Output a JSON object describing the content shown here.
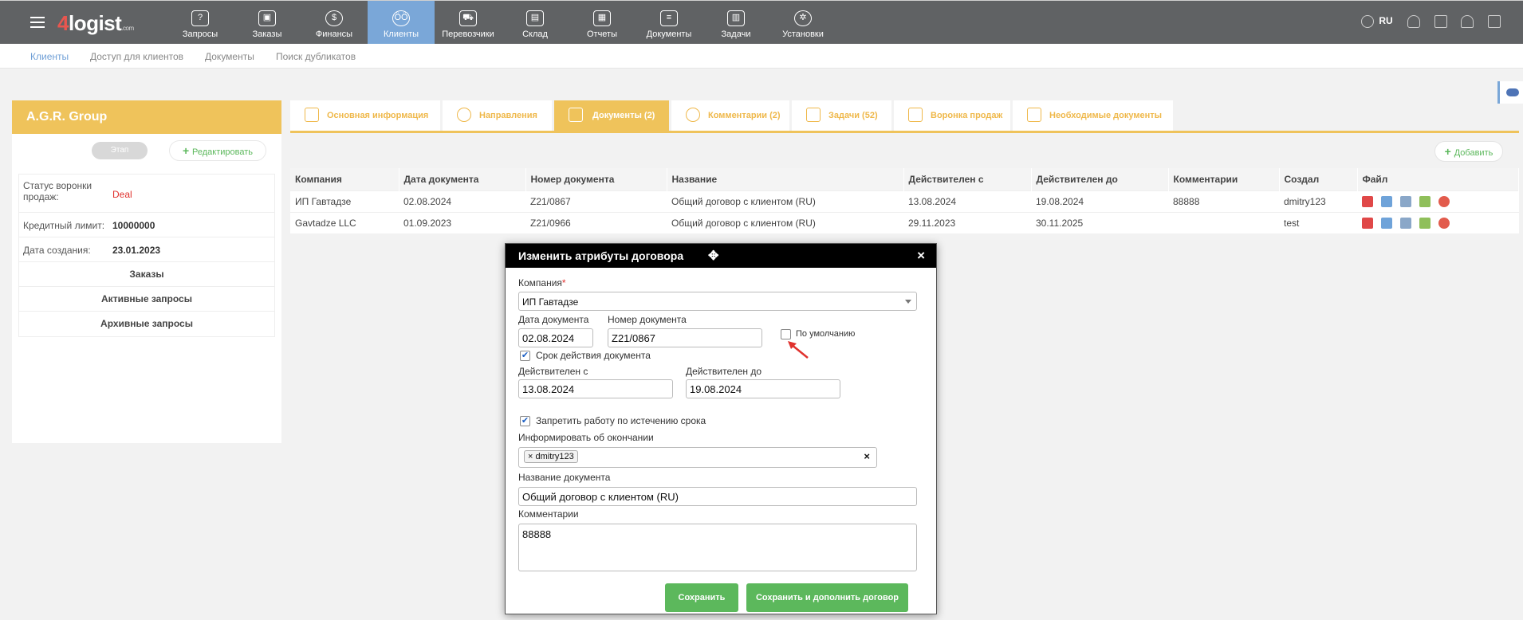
{
  "logo": {
    "four": "4",
    "rest": "logist",
    "suffix": ".com"
  },
  "nav": [
    {
      "label": "Запросы",
      "icon": "chat-icon"
    },
    {
      "label": "Заказы",
      "icon": "boxes-icon"
    },
    {
      "label": "Финансы",
      "icon": "money-bag-icon"
    },
    {
      "label": "Клиенты",
      "icon": "users-icon",
      "active": true
    },
    {
      "label": "Перевозчики",
      "icon": "truck-icon"
    },
    {
      "label": "Склад",
      "icon": "warehouse-icon"
    },
    {
      "label": "Отчеты",
      "icon": "calculator-icon"
    },
    {
      "label": "Документы",
      "icon": "document-icon"
    },
    {
      "label": "Задачи",
      "icon": "calendar-icon"
    },
    {
      "label": "Установки",
      "icon": "gear-icon"
    }
  ],
  "top_right": {
    "lang": "RU"
  },
  "subnav": [
    "Клиенты",
    "Доступ для клиентов",
    "Документы",
    "Поиск дубликатов"
  ],
  "client": {
    "name": "A.G.R. Group",
    "stage_button": "Этап",
    "edit_button": "Редактировать",
    "status_label": "Статус воронки продаж:",
    "status_value": "Deal",
    "credit_label": "Кредитный лимит:",
    "credit_value": "10000000",
    "created_label": "Дата создания:",
    "created_value": "23.01.2023",
    "sections": [
      "Заказы",
      "Активные запросы",
      "Архивные запросы"
    ]
  },
  "tabs": [
    "Основная информация",
    "Направления",
    "Документы (2)",
    "Комментарии (2)",
    "Задачи (52)",
    "Воронка продаж",
    "Необходимые документы"
  ],
  "add_button": "Добавить",
  "table": {
    "headers": [
      "Компания",
      "Дата документа",
      "Номер документа",
      "Название",
      "Действителен с",
      "Действителен до",
      "Комментарии",
      "Создал",
      "Файл"
    ],
    "rows": [
      [
        "ИП Гавтадзе",
        "02.08.2024",
        "Z21/0867",
        "Общий договор с клиентом (RU)",
        "13.08.2024",
        "19.08.2024",
        "88888",
        "dmitry123"
      ],
      [
        "Gavtadze LLC",
        "01.09.2023",
        "Z21/0966",
        "Общий договор с клиентом (RU)",
        "29.11.2023",
        "30.11.2025",
        "",
        "test"
      ]
    ]
  },
  "modal": {
    "title": "Изменить атрибуты договора",
    "close": "×",
    "company_label": "Компания",
    "company_required": "*",
    "company_value": "ИП Гавтадзе",
    "doc_date_label": "Дата документа",
    "doc_date_value": "02.08.2024",
    "doc_num_label": "Номер документа",
    "doc_num_value": "Z21/0867",
    "default_label": "По умолчанию",
    "validity_label": "Срок действия документа",
    "valid_from_label": "Действителен с",
    "valid_from_value": "13.08.2024",
    "valid_to_label": "Действителен до",
    "valid_to_value": "19.08.2024",
    "forbid_label": "Запретить работу по истечению срока",
    "inform_label": "Информировать об окончании",
    "inform_tag": "dmitry123",
    "docname_label": "Название документа",
    "docname_value": "Общий договор с клиентом (RU)",
    "comments_label": "Комментарии",
    "comments_value": "88888",
    "save_button": "Сохранить",
    "save_more_button": "Сохранить и дополнить договор"
  }
}
